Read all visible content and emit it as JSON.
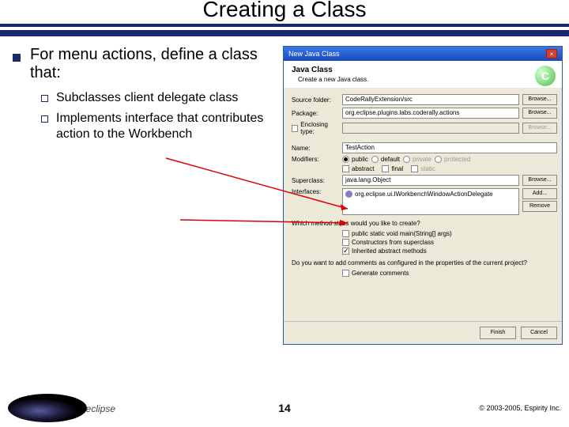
{
  "slide": {
    "title": "Creating a Class",
    "page": "14",
    "copyright": "© 2003-2005, Espirity Inc.",
    "logo": "eclipse"
  },
  "bullets": {
    "main": "For menu actions, define a class that:",
    "sub1": "Subclasses client delegate class",
    "sub2": "Implements interface that contributes action to the Workbench"
  },
  "dialog": {
    "title": "New Java Class",
    "head1": "Java Class",
    "head2": "Create a new Java class.",
    "icon": "C",
    "sourceFolder": {
      "lbl": "Source folder:",
      "val": "CodeRallyExtension/src",
      "btn": "Browse..."
    },
    "package": {
      "lbl": "Package:",
      "val": "org.eclipse.plugins.labs.coderally.actions",
      "btn": "Browse..."
    },
    "enclosing": {
      "lbl": "Enclosing type:",
      "val": "",
      "btn": "Browse..."
    },
    "name": {
      "lbl": "Name:",
      "val": "TestAction"
    },
    "modifiers": {
      "lbl": "Modifiers:",
      "public": "public",
      "default": "default",
      "private": "private",
      "protected": "protected",
      "abstract": "abstract",
      "final": "final",
      "static": "static"
    },
    "superclass": {
      "lbl": "Superclass:",
      "val": "java.lang.Object",
      "btn": "Browse..."
    },
    "interfaces": {
      "lbl": "Interfaces:",
      "item": "org.eclipse.ui.IWorkbenchWindowActionDelegate",
      "add": "Add...",
      "remove": "Remove"
    },
    "stubsQ": "Which method stubs would you like to create?",
    "stubs": {
      "main": "public static void main(String[] args)",
      "super": "Constructors from superclass",
      "inh": "Inherited abstract methods"
    },
    "commentsQ": "Do you want to add comments as configured in the properties of the current project?",
    "gen": "Generate comments",
    "finish": "Finish",
    "cancel": "Cancel"
  }
}
